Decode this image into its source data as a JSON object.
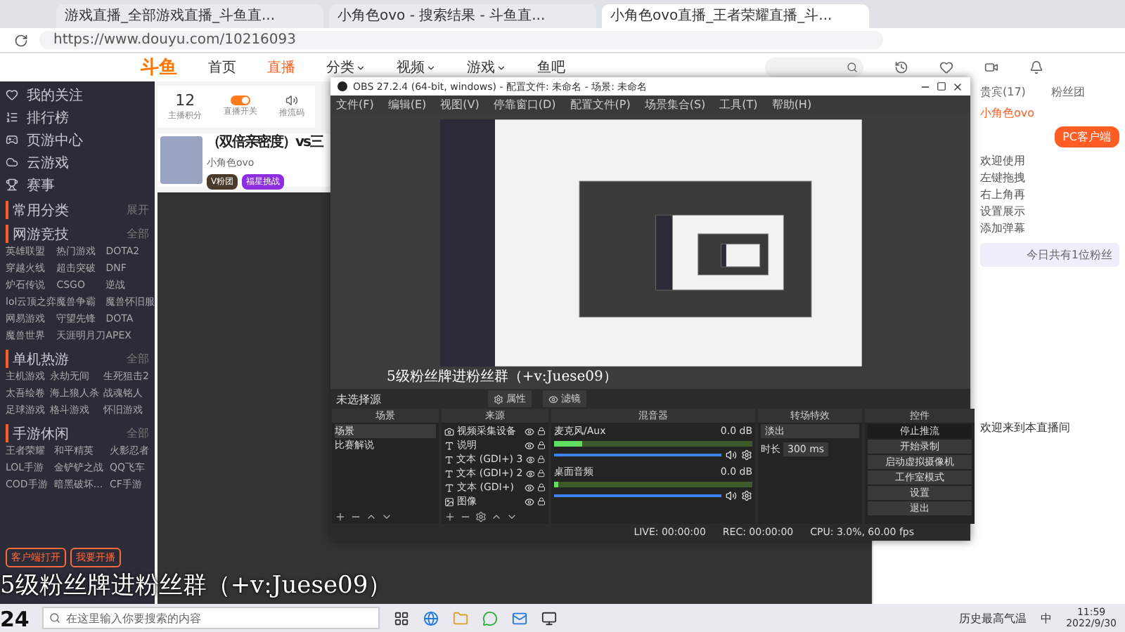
{
  "browser": {
    "tabs": [
      {
        "title": "游戏直播_全部游戏直播_斗鱼直...",
        "selected": false
      },
      {
        "title": "小角色ovo - 搜索结果 - 斗鱼直...",
        "selected": false
      },
      {
        "title": "小角色ovo直播_王者荣耀直播_斗...",
        "selected": true
      }
    ],
    "url": "https://www.douyu.com/10216093"
  },
  "site": {
    "logo": "斗鱼",
    "nav": [
      {
        "label": "首页",
        "selected": false,
        "dropdown": false
      },
      {
        "label": "直播",
        "selected": true,
        "dropdown": false
      },
      {
        "label": "分类",
        "selected": false,
        "dropdown": true
      },
      {
        "label": "视频",
        "selected": false,
        "dropdown": true
      },
      {
        "label": "游戏",
        "selected": false,
        "dropdown": true
      },
      {
        "label": "鱼吧",
        "selected": false,
        "dropdown": false
      }
    ]
  },
  "sidebar": {
    "menu": [
      "我的关注",
      "排行榜",
      "页游中心",
      "云游戏",
      "赛事"
    ],
    "sections": [
      {
        "title": "常用分类",
        "more": "展开"
      },
      {
        "title": "网游竞技",
        "more": "全部",
        "items": [
          "英雄联盟",
          "热门游戏",
          "DOTA2",
          "穿越火线",
          "超击突破",
          "DNF",
          "炉石传说",
          "CSGO",
          "逆战",
          "lol云顶之弈",
          "魔兽争霸",
          "魔兽怀旧服",
          "网易游戏",
          "守望先锋",
          "DOTA",
          "魔兽世界",
          "天涯明月刀",
          "APEX"
        ]
      },
      {
        "title": "单机热游",
        "more": "全部",
        "items": [
          "主机游戏",
          "永劫无间",
          "生死狙击2",
          "太吾绘卷",
          "海上狼人杀",
          "战魂铭人",
          "足球游戏",
          "格斗游戏",
          "怀旧游戏"
        ]
      },
      {
        "title": "手游休闲",
        "more": "全部",
        "items": [
          "王者荣耀",
          "和平精英",
          "火影忍者",
          "LOL手游",
          "金铲铲之战",
          "QQ飞车",
          "COD手游",
          "暗黑破坏...",
          "CF手游"
        ]
      }
    ],
    "buttons": [
      "客户端打开",
      "我要开播"
    ]
  },
  "stats": {
    "score": "12",
    "score_label": "主播积分",
    "toggle_label": "直播开关",
    "toggle_on": true,
    "third_label": "推流码"
  },
  "streamer": {
    "title": "（双倍亲密度）vs三",
    "name": "小角色ovo",
    "badges": [
      "V粉团",
      "福星挑战"
    ]
  },
  "obs": {
    "title": "OBS 27.2.4 (64-bit, windows) - 配置文件: 未命名 - 场景: 未命名",
    "menu": [
      "文件(F)",
      "编辑(E)",
      "视图(V)",
      "停靠窗口(D)",
      "配置文件(P)",
      "场景集合(S)",
      "工具(T)",
      "帮助(H)"
    ],
    "preview_caption": "5级粉丝牌进粉丝群（+v:Juese09）",
    "source_bar": {
      "label": "未选择源",
      "buttons": [
        "属性",
        "滤镜"
      ]
    },
    "docks": [
      "场景",
      "来源",
      "混音器",
      "转场特效",
      "控件"
    ],
    "scenes": [
      {
        "name": "场景",
        "selected": true
      },
      {
        "name": "比赛解说",
        "selected": false
      }
    ],
    "sources": [
      {
        "name": "视频采集设备",
        "kind": "camera",
        "visible": true
      },
      {
        "name": "说明",
        "kind": "text",
        "visible": true
      },
      {
        "name": "文本 (GDI+) 3",
        "kind": "text",
        "visible": true
      },
      {
        "name": "文本 (GDI+) 2",
        "kind": "text",
        "visible": true
      },
      {
        "name": "文本 (GDI+)",
        "kind": "text",
        "visible": true
      },
      {
        "name": "图像",
        "kind": "image",
        "visible": true
      }
    ],
    "mixer": [
      {
        "name": "麦克风/Aux",
        "reading": "0.0 dB",
        "level": 0.14,
        "volume": {
          "level": 1.0
        }
      },
      {
        "name": "桌面音频",
        "reading": "0.0 dB",
        "level": 0.02,
        "volume": {
          "level": 1.0
        }
      }
    ],
    "transition": {
      "name": "淡出",
      "duration_label": "时长",
      "duration": "300 ms"
    },
    "controls": [
      {
        "label": "停止推流",
        "active": true
      },
      {
        "label": "开始录制",
        "active": false
      },
      {
        "label": "启动虚拟摄像机",
        "active": false
      },
      {
        "label": "工作室模式",
        "active": false
      },
      {
        "label": "设置",
        "active": false
      },
      {
        "label": "退出",
        "active": false
      }
    ],
    "status": [
      "LIVE: 00:00:00",
      "REC: 00:00:00",
      "CPU: 3.0%, 60.00 fps"
    ]
  },
  "chat": {
    "tabs": [
      {
        "label": "贵宾(17)",
        "selected": false
      },
      {
        "label": "粉丝团",
        "selected": false
      }
    ],
    "host_name": "小角色ovo",
    "client_button": "PC客户端",
    "notice": [
      "欢迎使用",
      "左键拖拽",
      "右上角再",
      "设置展示",
      "添加弹幕"
    ],
    "signin": "今日共有1位粉丝",
    "welcome": "欢迎来到本直播间"
  },
  "caption": "5级粉丝牌进粉丝群（+v:Juese09）",
  "corner": "24",
  "taskbar": {
    "search_placeholder": "在这里输入你要搜索的内容",
    "weather": "历史最高气温",
    "ime": "中",
    "time": "11:59",
    "date": "2022/9/30"
  }
}
